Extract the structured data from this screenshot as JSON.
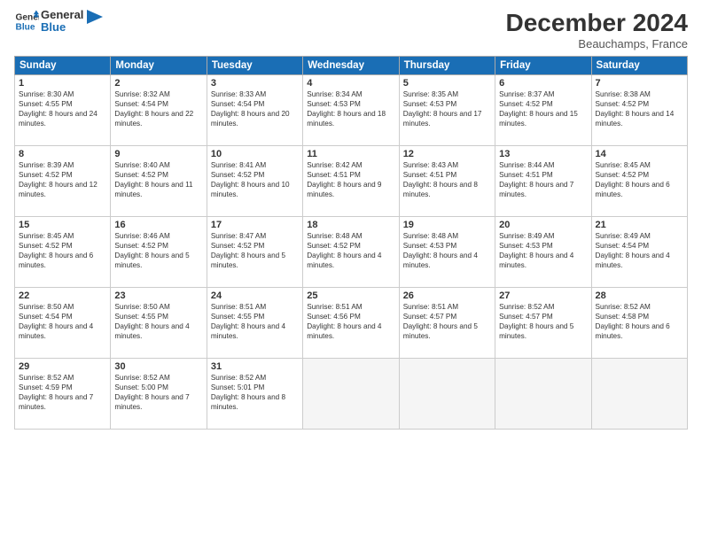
{
  "header": {
    "logo_line1": "General",
    "logo_line2": "Blue",
    "month": "December 2024",
    "location": "Beauchamps, France"
  },
  "days_of_week": [
    "Sunday",
    "Monday",
    "Tuesday",
    "Wednesday",
    "Thursday",
    "Friday",
    "Saturday"
  ],
  "weeks": [
    [
      {
        "day": "1",
        "sunrise": "8:30 AM",
        "sunset": "4:55 PM",
        "daylight": "8 hours and 24 minutes"
      },
      {
        "day": "2",
        "sunrise": "8:32 AM",
        "sunset": "4:54 PM",
        "daylight": "8 hours and 22 minutes"
      },
      {
        "day": "3",
        "sunrise": "8:33 AM",
        "sunset": "4:54 PM",
        "daylight": "8 hours and 20 minutes"
      },
      {
        "day": "4",
        "sunrise": "8:34 AM",
        "sunset": "4:53 PM",
        "daylight": "8 hours and 18 minutes"
      },
      {
        "day": "5",
        "sunrise": "8:35 AM",
        "sunset": "4:53 PM",
        "daylight": "8 hours and 17 minutes"
      },
      {
        "day": "6",
        "sunrise": "8:37 AM",
        "sunset": "4:52 PM",
        "daylight": "8 hours and 15 minutes"
      },
      {
        "day": "7",
        "sunrise": "8:38 AM",
        "sunset": "4:52 PM",
        "daylight": "8 hours and 14 minutes"
      }
    ],
    [
      {
        "day": "8",
        "sunrise": "8:39 AM",
        "sunset": "4:52 PM",
        "daylight": "8 hours and 12 minutes"
      },
      {
        "day": "9",
        "sunrise": "8:40 AM",
        "sunset": "4:52 PM",
        "daylight": "8 hours and 11 minutes"
      },
      {
        "day": "10",
        "sunrise": "8:41 AM",
        "sunset": "4:52 PM",
        "daylight": "8 hours and 10 minutes"
      },
      {
        "day": "11",
        "sunrise": "8:42 AM",
        "sunset": "4:51 PM",
        "daylight": "8 hours and 9 minutes"
      },
      {
        "day": "12",
        "sunrise": "8:43 AM",
        "sunset": "4:51 PM",
        "daylight": "8 hours and 8 minutes"
      },
      {
        "day": "13",
        "sunrise": "8:44 AM",
        "sunset": "4:51 PM",
        "daylight": "8 hours and 7 minutes"
      },
      {
        "day": "14",
        "sunrise": "8:45 AM",
        "sunset": "4:52 PM",
        "daylight": "8 hours and 6 minutes"
      }
    ],
    [
      {
        "day": "15",
        "sunrise": "8:45 AM",
        "sunset": "4:52 PM",
        "daylight": "8 hours and 6 minutes"
      },
      {
        "day": "16",
        "sunrise": "8:46 AM",
        "sunset": "4:52 PM",
        "daylight": "8 hours and 5 minutes"
      },
      {
        "day": "17",
        "sunrise": "8:47 AM",
        "sunset": "4:52 PM",
        "daylight": "8 hours and 5 minutes"
      },
      {
        "day": "18",
        "sunrise": "8:48 AM",
        "sunset": "4:52 PM",
        "daylight": "8 hours and 4 minutes"
      },
      {
        "day": "19",
        "sunrise": "8:48 AM",
        "sunset": "4:53 PM",
        "daylight": "8 hours and 4 minutes"
      },
      {
        "day": "20",
        "sunrise": "8:49 AM",
        "sunset": "4:53 PM",
        "daylight": "8 hours and 4 minutes"
      },
      {
        "day": "21",
        "sunrise": "8:49 AM",
        "sunset": "4:54 PM",
        "daylight": "8 hours and 4 minutes"
      }
    ],
    [
      {
        "day": "22",
        "sunrise": "8:50 AM",
        "sunset": "4:54 PM",
        "daylight": "8 hours and 4 minutes"
      },
      {
        "day": "23",
        "sunrise": "8:50 AM",
        "sunset": "4:55 PM",
        "daylight": "8 hours and 4 minutes"
      },
      {
        "day": "24",
        "sunrise": "8:51 AM",
        "sunset": "4:55 PM",
        "daylight": "8 hours and 4 minutes"
      },
      {
        "day": "25",
        "sunrise": "8:51 AM",
        "sunset": "4:56 PM",
        "daylight": "8 hours and 4 minutes"
      },
      {
        "day": "26",
        "sunrise": "8:51 AM",
        "sunset": "4:57 PM",
        "daylight": "8 hours and 5 minutes"
      },
      {
        "day": "27",
        "sunrise": "8:52 AM",
        "sunset": "4:57 PM",
        "daylight": "8 hours and 5 minutes"
      },
      {
        "day": "28",
        "sunrise": "8:52 AM",
        "sunset": "4:58 PM",
        "daylight": "8 hours and 6 minutes"
      }
    ],
    [
      {
        "day": "29",
        "sunrise": "8:52 AM",
        "sunset": "4:59 PM",
        "daylight": "8 hours and 7 minutes"
      },
      {
        "day": "30",
        "sunrise": "8:52 AM",
        "sunset": "5:00 PM",
        "daylight": "8 hours and 7 minutes"
      },
      {
        "day": "31",
        "sunrise": "8:52 AM",
        "sunset": "5:01 PM",
        "daylight": "8 hours and 8 minutes"
      },
      null,
      null,
      null,
      null
    ]
  ]
}
